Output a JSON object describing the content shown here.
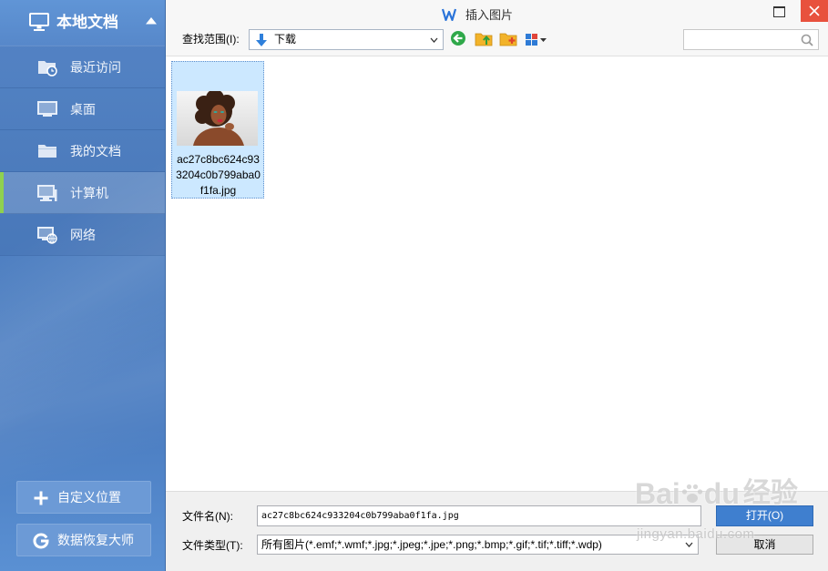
{
  "window": {
    "title": "插入图片",
    "logo_icon": "wps-writer-icon",
    "maximize_icon": "maximize-icon",
    "close_icon": "close-icon",
    "colors": {
      "close": "#e8513d",
      "accent": "#3f7fcf",
      "sidebar": "#4f80c2",
      "sidebar_selected_bar": "#8fd14f",
      "file_selection": "#cce8ff"
    }
  },
  "sidebar": {
    "title": "本地文档",
    "title_icon": "monitor-icon",
    "collapse_icon": "chevron-up-icon",
    "items": [
      {
        "label": "最近访问",
        "icon": "recent-folder-icon",
        "selected": false
      },
      {
        "label": "桌面",
        "icon": "desktop-icon",
        "selected": false
      },
      {
        "label": "我的文档",
        "icon": "folder-icon",
        "selected": false
      },
      {
        "label": "计算机",
        "icon": "computer-icon",
        "selected": true
      },
      {
        "label": "网络",
        "icon": "network-icon",
        "selected": false
      }
    ],
    "actions": [
      {
        "label": "自定义位置",
        "icon": "plus-icon"
      },
      {
        "label": "数据恢复大师",
        "icon": "data-recovery-icon"
      }
    ]
  },
  "toolbar": {
    "look_in_label": "查找范围(I):",
    "look_in_value": "下载",
    "look_in_icon": "download-arrow-icon",
    "buttons": [
      {
        "icon": "back-icon"
      },
      {
        "icon": "folder-up-icon"
      },
      {
        "icon": "new-folder-icon"
      },
      {
        "icon": "view-menu-icon"
      }
    ],
    "search_value": "",
    "search_icon": "search-icon"
  },
  "files": [
    {
      "name": "ac27c8bc624c933204c0b799aba0f1fa.jpg",
      "selected": true
    }
  ],
  "footer": {
    "file_name_label": "文件名(N):",
    "file_name_value": "ac27c8bc624c933204c0b799aba0f1fa.jpg",
    "file_type_label": "文件类型(T):",
    "file_type_value": "所有图片(*.emf;*.wmf;*.jpg;*.jpeg;*.jpe;*.png;*.bmp;*.gif;*.tif;*.tiff;*.wdp)",
    "open_label": "打开(O)",
    "cancel_label": "取消"
  },
  "watermark": {
    "brand_left": "Bai",
    "brand_right": "du",
    "product": "经验",
    "url": "jingyan.baidu.com"
  }
}
